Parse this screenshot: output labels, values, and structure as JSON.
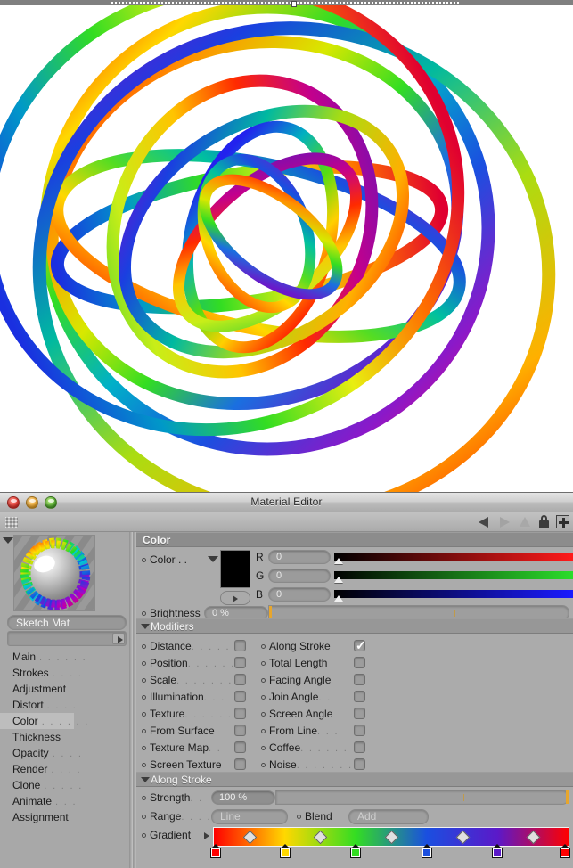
{
  "window": {
    "title": "Material Editor",
    "traffic_lights": [
      "close",
      "minimize",
      "maximize"
    ],
    "toolbar_icons": [
      "back-arrow-icon",
      "forward-arrow-icon",
      "up-arrow-icon",
      "lock-icon",
      "plus-icon"
    ]
  },
  "sidebar": {
    "material_name": "Sketch Mat",
    "layer_field_value": "",
    "channels": [
      {
        "label": "Main",
        "dots": ". . . . . .",
        "selected": false
      },
      {
        "label": "Strokes",
        "dots": ". . . .",
        "selected": false
      },
      {
        "label": "Adjustment",
        "dots": "",
        "selected": false
      },
      {
        "label": "Distort",
        "dots": ". . . .",
        "selected": false
      },
      {
        "label": "Color",
        "dots": ". . . . . .",
        "selected": true
      },
      {
        "label": "Thickness",
        "dots": "",
        "selected": false
      },
      {
        "label": "Opacity",
        "dots": ". . . .",
        "selected": false
      },
      {
        "label": "Render",
        "dots": ". . . .",
        "selected": false
      },
      {
        "label": "Clone",
        "dots": ". . . . .",
        "selected": false
      },
      {
        "label": "Animate",
        "dots": ". . .",
        "selected": false
      },
      {
        "label": "Assignment",
        "dots": "",
        "selected": false
      }
    ]
  },
  "color_section": {
    "header": "Color",
    "color_label": "Color . .",
    "swatch_hex": "#000000",
    "channels": [
      {
        "name": "R",
        "value": "0",
        "track_from": "#000000",
        "track_to": "#ff1a1a",
        "knob_pct": 0
      },
      {
        "name": "G",
        "value": "0",
        "track_from": "#000000",
        "track_to": "#2bdd2b",
        "knob_pct": 0
      },
      {
        "name": "B",
        "value": "0",
        "track_from": "#000000",
        "track_to": "#1a1aff",
        "knob_pct": 0
      }
    ],
    "brightness_label": "Brightness",
    "brightness_value": "0 %",
    "brightness_pct": 0
  },
  "modifiers": {
    "header": "Modifiers",
    "left_column": [
      {
        "label": "Distance",
        "dots": ". . . . . .",
        "checked": false
      },
      {
        "label": "Position",
        "dots": ". . . . . .",
        "checked": false
      },
      {
        "label": "Scale",
        "dots": ". . . . . . . .",
        "checked": false
      },
      {
        "label": "Illumination",
        "dots": ". . .",
        "checked": false
      },
      {
        "label": "Texture",
        "dots": ". . . . . . .",
        "checked": false
      },
      {
        "label": "From Surface",
        "dots": "",
        "checked": false
      },
      {
        "label": "Texture Map",
        "dots": ". .",
        "checked": false
      },
      {
        "label": "Screen Texture",
        "dots": "",
        "checked": false
      }
    ],
    "right_column": [
      {
        "label": "Along Stroke",
        "dots": "",
        "checked": true
      },
      {
        "label": "Total Length",
        "dots": "",
        "checked": false
      },
      {
        "label": "Facing Angle",
        "dots": "",
        "checked": false
      },
      {
        "label": "Join Angle",
        "dots": ". .",
        "checked": false
      },
      {
        "label": "Screen Angle",
        "dots": "",
        "checked": false
      },
      {
        "label": "From Line",
        "dots": ". . .",
        "checked": false
      },
      {
        "label": "Coffee",
        "dots": ". . . . . .",
        "checked": false
      },
      {
        "label": "Noise",
        "dots": ". . . . . . .",
        "checked": false
      }
    ]
  },
  "along_stroke": {
    "header": "Along Stroke",
    "strength_label": "Strength",
    "strength_dots": ". .",
    "strength_value": "100 %",
    "strength_pct": 100,
    "range_label": "Range",
    "range_dots": ". . . .",
    "range_value": "Line",
    "blend_label": "Blend",
    "blend_value": "Add",
    "gradient_label": "Gradient",
    "gradient_stops": [
      {
        "pos": 0,
        "hex": "#ff0000"
      },
      {
        "pos": 20,
        "hex": "#ffd800"
      },
      {
        "pos": 40,
        "hex": "#33dd22"
      },
      {
        "pos": 60,
        "hex": "#1a4fe0"
      },
      {
        "pos": 80,
        "hex": "#5b19c9"
      },
      {
        "pos": 100,
        "hex": "#ff0000"
      }
    ],
    "gradient_midpoints": [
      10,
      30,
      50,
      70,
      90
    ]
  },
  "viewport": {
    "background_hex": "#ffffff",
    "description": "rainbow sketch-shaded torus knot rings"
  }
}
